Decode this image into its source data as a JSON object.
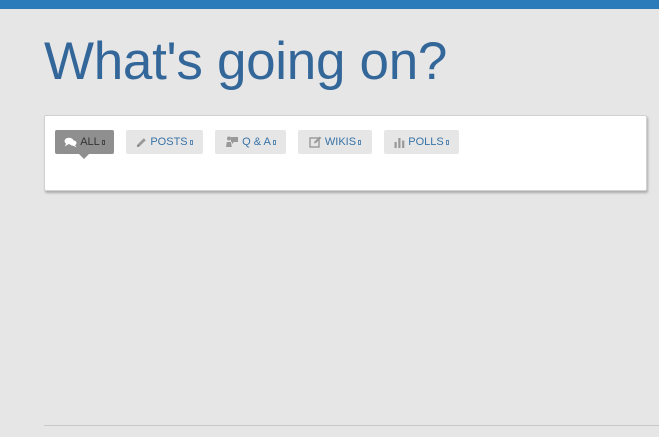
{
  "page": {
    "title": "What's going on?"
  },
  "filters": {
    "tabs": [
      {
        "label": "ALL",
        "icon": "comments-icon",
        "active": true
      },
      {
        "label": "POSTS",
        "icon": "pencil-icon",
        "active": false
      },
      {
        "label": "Q & A",
        "icon": "qa-icon",
        "active": false
      },
      {
        "label": "WIKIS",
        "icon": "edit-icon",
        "active": false
      },
      {
        "label": "POLLS",
        "icon": "bar-chart-icon",
        "active": false
      }
    ]
  },
  "colors": {
    "accent": "#2b7bbb",
    "title": "#336699",
    "tab_text": "#3873a6",
    "active_tab": "#8f8f8f"
  }
}
